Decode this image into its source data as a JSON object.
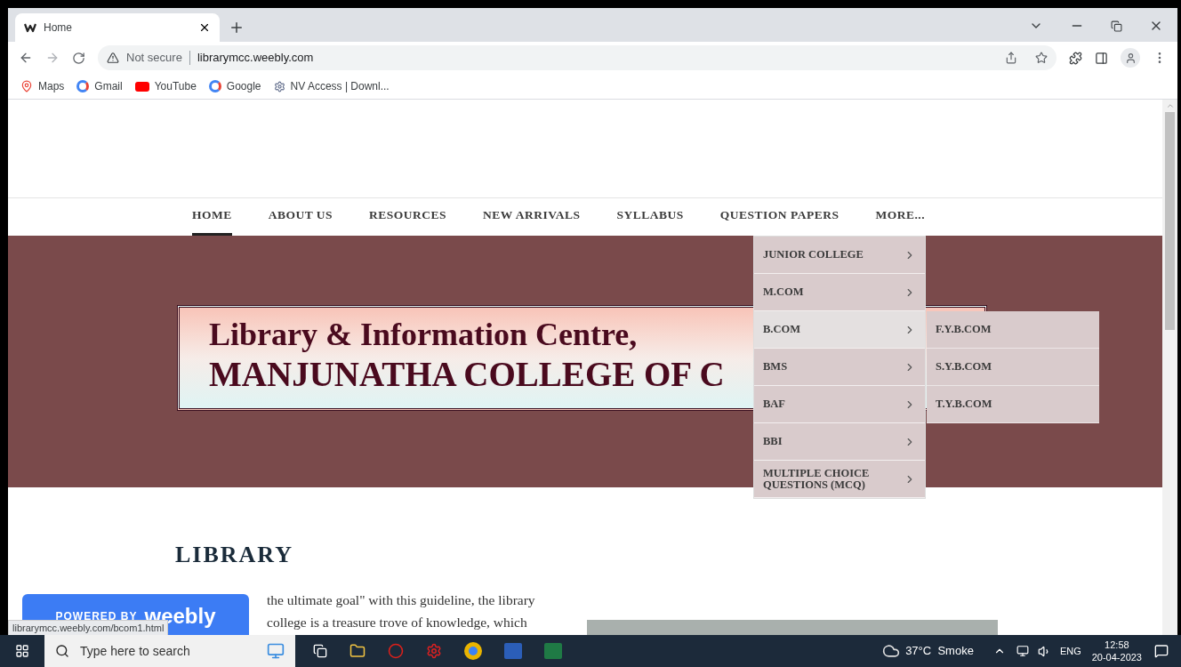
{
  "browser": {
    "tab": {
      "title": "Home",
      "selected": true
    },
    "address": {
      "security": "Not secure",
      "url": "librarymcc.weebly.com"
    },
    "bookmarks": [
      {
        "kind": "maps",
        "label": "Maps"
      },
      {
        "kind": "google",
        "label": "Gmail"
      },
      {
        "kind": "youtube",
        "label": "YouTube"
      },
      {
        "kind": "google",
        "label": "Google"
      },
      {
        "kind": "gear",
        "label": "NV Access | Downl..."
      }
    ],
    "status_url": "librarymcc.weebly.com/bcom1.html"
  },
  "nav": [
    {
      "label": "HOME",
      "selected": true
    },
    {
      "label": "ABOUT US",
      "selected": false
    },
    {
      "label": "RESOURCES",
      "selected": false
    },
    {
      "label": "NEW ARRIVALS",
      "selected": false
    },
    {
      "label": "SYLLABUS",
      "selected": false
    },
    {
      "label": "QUESTION PAPERS",
      "selected": false
    },
    {
      "label": "MORE...",
      "selected": false
    }
  ],
  "dropdown": [
    {
      "label": "JUNIOR COLLEGE",
      "selected": false
    },
    {
      "label": "M.COM",
      "selected": false
    },
    {
      "label": "B.COM",
      "selected": true
    },
    {
      "label": "BMS",
      "selected": false
    },
    {
      "label": "BAF",
      "selected": false
    },
    {
      "label": "BBI",
      "selected": false
    },
    {
      "label": "MULTIPLE CHOICE QUESTIONS (MCQ)",
      "selected": false
    }
  ],
  "submenu": [
    "F.Y.B.COM",
    "S.Y.B.COM",
    "T.Y.B.COM"
  ],
  "banner": {
    "line1": "Library & Information Centre,",
    "line2": "MANJUNATHA COLLEGE OF C"
  },
  "section": {
    "heading": "LIBRARY",
    "lines": [
      "the ultimate goal\" with this guideline, the library",
      "college is a treasure trove of knowledge, which"
    ]
  },
  "badge": {
    "prefix": "POWERED BY",
    "brand": "weebly"
  },
  "taskbar": {
    "search_placeholder": "Type here to search",
    "weather": "37°C  Smoke",
    "language": "ENG",
    "time": "12:58",
    "date": "20-04-2023"
  }
}
